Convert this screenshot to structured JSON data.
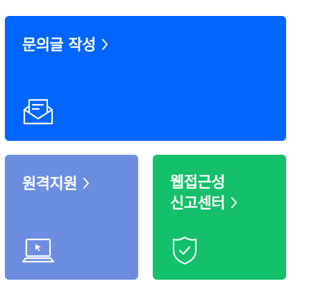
{
  "colors": {
    "inquiry": "#0066ff",
    "remote": "#6b8ee0",
    "accessibility": "#14c06a"
  },
  "cards": {
    "inquiry": {
      "title": "문의글 작성",
      "icon": "envelope-letter-icon"
    },
    "remote": {
      "title": "원격지원",
      "icon": "laptop-cursor-icon"
    },
    "accessibility": {
      "title_line1": "웹접근성",
      "title_line2": "신고센터",
      "icon": "shield-check-icon"
    }
  }
}
